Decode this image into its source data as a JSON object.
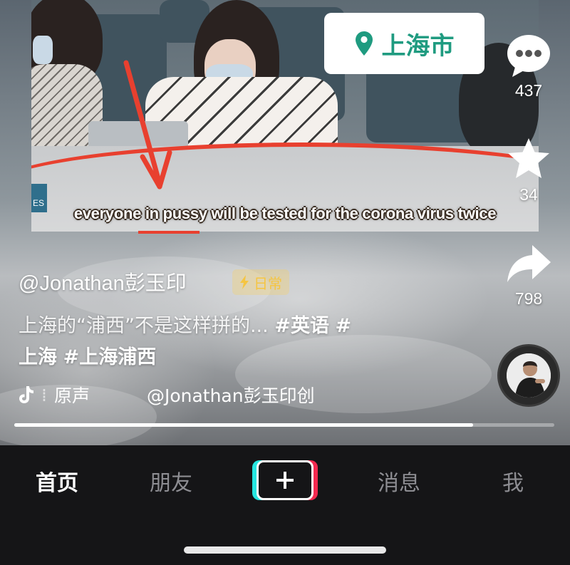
{
  "video": {
    "subtitle": "everyone in pussy will be tested for the corona virus twice",
    "corner_tag": "ES",
    "location": "上海市"
  },
  "rail": {
    "comments_count": "437",
    "favorites_count": "34",
    "shares_count": "798"
  },
  "caption": {
    "author": "@Jonathan彭玉印",
    "tag": "日常",
    "desc_lead": "上海的“浦西”不是这样拼的...",
    "hashtag_1": "#英语",
    "hashtag_2": "#",
    "hashtag_3": "上海",
    "hashtag_4": "#上海浦西",
    "music_label": "原声",
    "music_author": "@Jonathan彭玉印创"
  },
  "progress": {
    "played_fraction": 0.85
  },
  "nav": {
    "home": "首页",
    "friends": "朋友",
    "messages": "消息",
    "me": "我"
  },
  "colors": {
    "location_text": "#1f9b80",
    "annotation_red": "#e8402f",
    "tag_gold": "#f5c542",
    "nav_bg": "#151517",
    "tiktok_cyan": "#25e6e0",
    "tiktok_red": "#f2294f"
  },
  "icons": {
    "location": "map-pin-icon",
    "comments": "speech-bubble-icon",
    "favorites": "star-icon",
    "share": "share-arrow-icon",
    "tag": "lightning-icon",
    "music": "tiktok-note-icon",
    "create": "plus-icon"
  }
}
